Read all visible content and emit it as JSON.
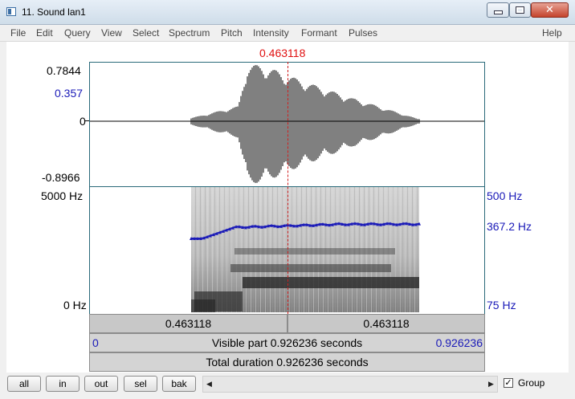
{
  "window": {
    "title": "11. Sound lan1"
  },
  "menu": [
    "File",
    "Edit",
    "Query",
    "View",
    "Select",
    "Spectrum",
    "Pitch",
    "Intensity",
    "Formant",
    "Pulses",
    "Help"
  ],
  "cursor": {
    "time": "0.463118"
  },
  "waveform": {
    "max_label": "0.7844",
    "cursor_value": "0.357",
    "zero_label": "0",
    "min_label": "-0.8966"
  },
  "spectrogram": {
    "top_freq": "5000 Hz",
    "bottom_freq": "0 Hz"
  },
  "pitch": {
    "top": "500 Hz",
    "current": "367.2 Hz",
    "bottom": "75 Hz"
  },
  "selection_bar": {
    "left": "0.463118",
    "right": "0.463118"
  },
  "visible_bar": {
    "start": "0",
    "label": "Visible part 0.926236 seconds",
    "end": "0.926236"
  },
  "total_bar": {
    "label": "Total duration 0.926236 seconds"
  },
  "buttons": [
    "all",
    "in",
    "out",
    "sel",
    "bak"
  ],
  "group": {
    "label": "Group",
    "checked": true
  },
  "colors": {
    "cursor": "#e01010",
    "pitch": "#1a1ab8",
    "frame": "#2a6a7a"
  }
}
